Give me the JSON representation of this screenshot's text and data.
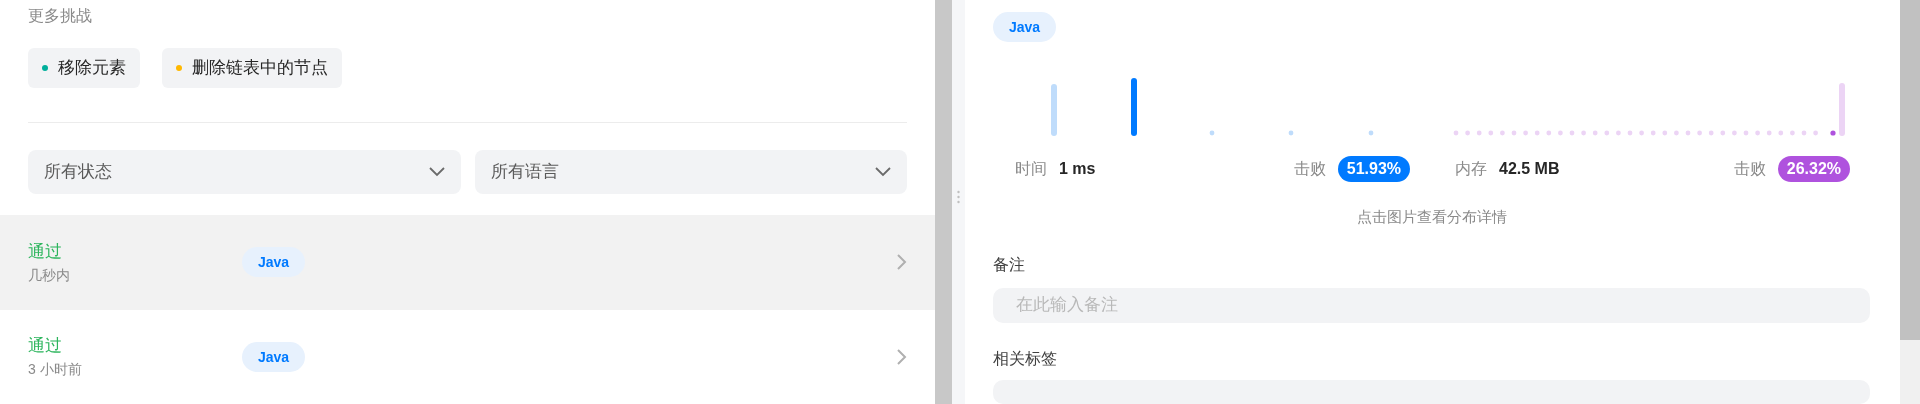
{
  "left": {
    "section_title": "更多挑战",
    "challenges": [
      {
        "label": "移除元素",
        "color": "#00af9b"
      },
      {
        "label": "删除链表中的节点",
        "color": "#ffb800"
      }
    ],
    "filters": [
      {
        "value": "所有状态"
      },
      {
        "value": "所有语言"
      }
    ],
    "submissions": [
      {
        "status": "通过",
        "time": "几秒内",
        "language": "Java",
        "selected": true
      },
      {
        "status": "通过",
        "time": "3 小时前",
        "language": "Java",
        "selected": false
      }
    ]
  },
  "right": {
    "language": "Java",
    "stats": [
      {
        "label": "时间",
        "value": "1 ms",
        "beat_label": "击败",
        "beat": "51.93%",
        "color": "#007aff"
      },
      {
        "label": "内存",
        "value": "42.5 MB",
        "beat_label": "击败",
        "beat": "26.32%",
        "color": "#af52de"
      }
    ],
    "chart_hint": "点击图片查看分布详情",
    "note": {
      "label": "备注",
      "placeholder": "在此输入备注"
    },
    "tags": {
      "label": "相关标签"
    }
  }
}
